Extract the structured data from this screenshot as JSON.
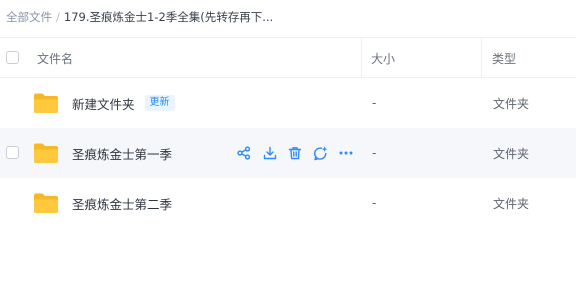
{
  "breadcrumb": {
    "root": "全部文件",
    "separator": "/",
    "current": "179.圣痕炼金士1-2季全集(先转存再下..."
  },
  "table": {
    "headers": {
      "name": "文件名",
      "size": "大小",
      "type": "类型"
    },
    "rows": [
      {
        "name": "新建文件夹",
        "badge": "更新",
        "size": "-",
        "type": "文件夹"
      },
      {
        "name": "圣痕炼金士第一季",
        "size": "-",
        "type": "文件夹",
        "hovered": true
      },
      {
        "name": "圣痕炼金士第二季",
        "size": "-",
        "type": "文件夹"
      }
    ]
  },
  "icons": {
    "folder": "folder-icon",
    "share": "share-icon",
    "download": "download-icon",
    "delete": "trash-icon",
    "assistant": "ai-chat-icon",
    "more": "more-icon"
  },
  "colors": {
    "accent": "#2a8cff",
    "folder": "#f5b829",
    "row_hover": "#f5f7fb"
  }
}
